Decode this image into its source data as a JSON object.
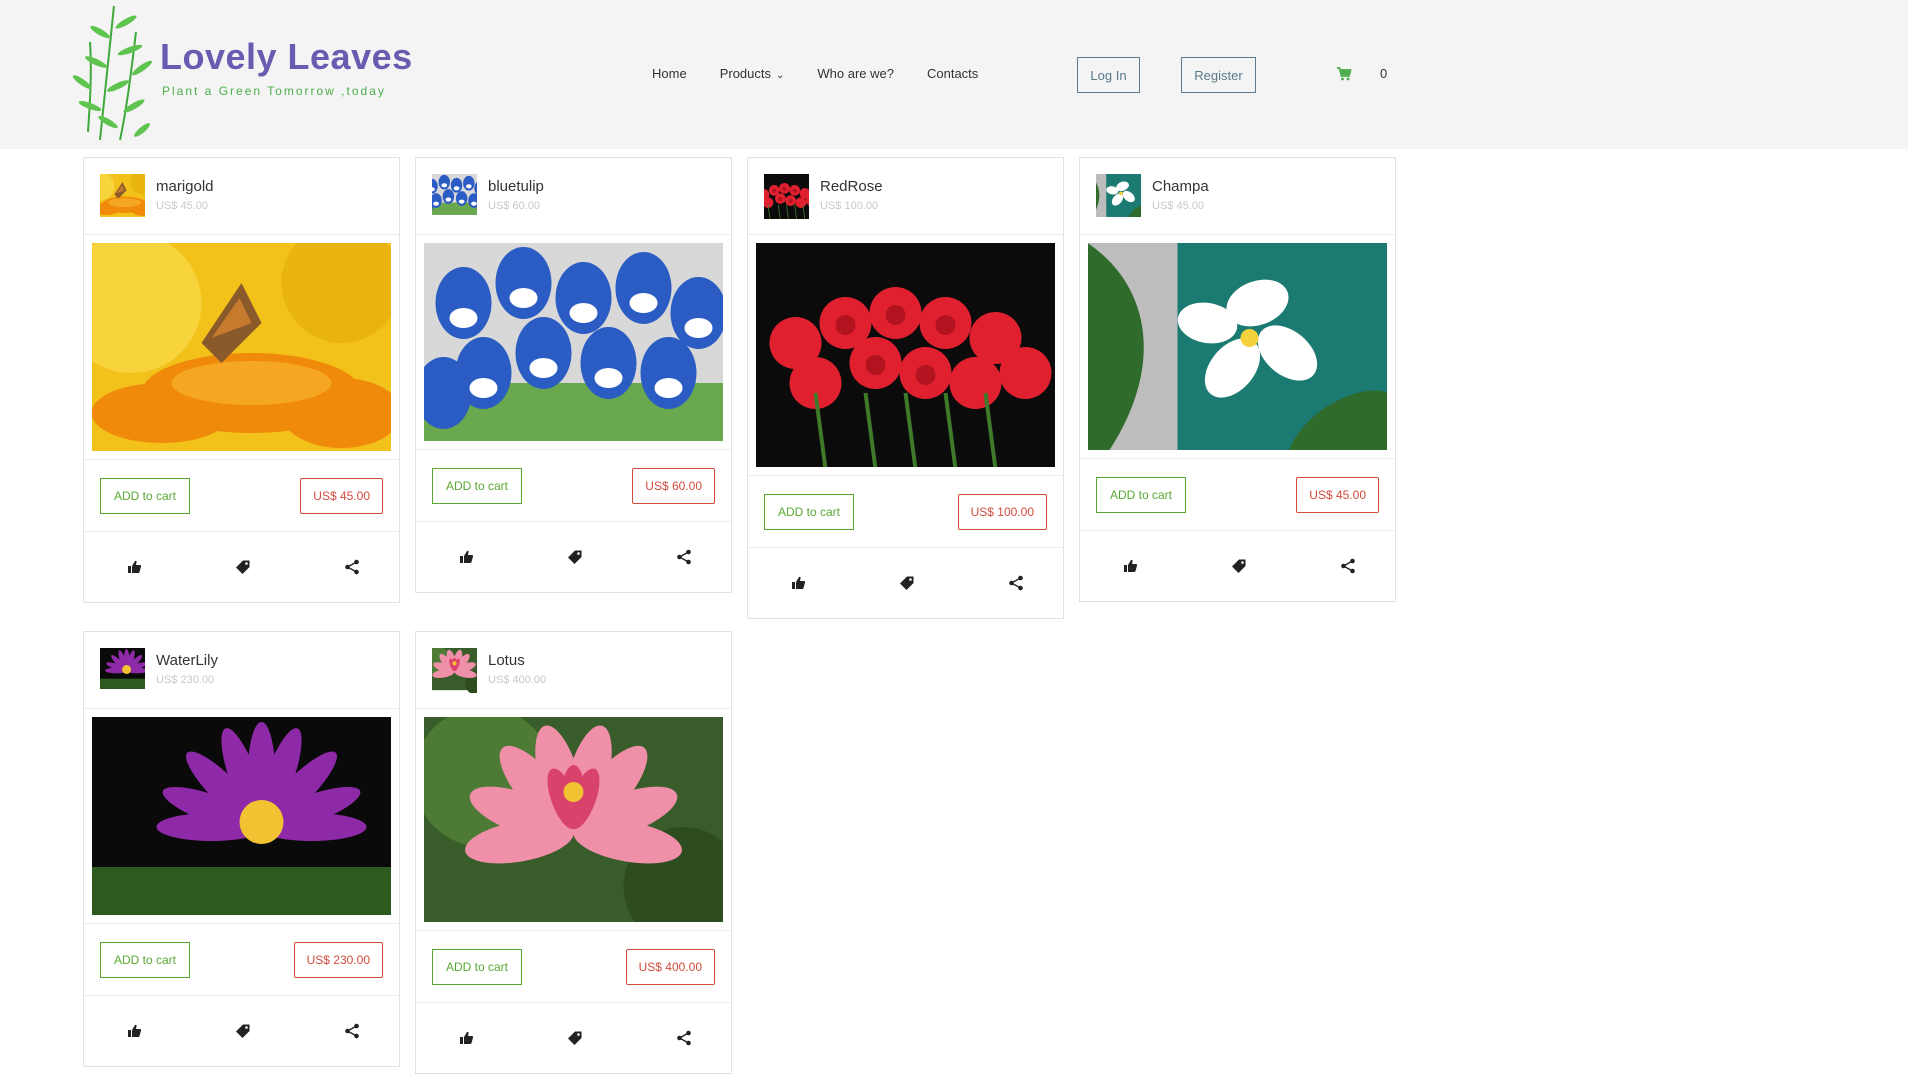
{
  "brand": {
    "title": "Lovely Leaves",
    "tagline": "Plant a Green Tomorrow ,today",
    "accent": "#6a5bb0",
    "tagline_color": "#4cae4c"
  },
  "nav": {
    "home": "Home",
    "products": "Products",
    "who": "Who are we?",
    "contacts": "Contacts"
  },
  "auth": {
    "login": "Log In",
    "register": "Register"
  },
  "cart": {
    "icon": "shopping-cart-icon",
    "count": "0"
  },
  "colors": {
    "add_green": "#5aa832",
    "price_red": "#d24b3c"
  },
  "products": [
    {
      "name": "marigold",
      "subprice": "US$ 45.00",
      "add": "ADD to cart",
      "price": "US$ 45.00"
    },
    {
      "name": "bluetulip",
      "subprice": "US$ 60.00",
      "add": "ADD to cart",
      "price": "US$ 60.00"
    },
    {
      "name": "RedRose",
      "subprice": "US$ 100.00",
      "add": "ADD to cart",
      "price": "US$ 100.00"
    },
    {
      "name": "Champa",
      "subprice": "US$ 45.00",
      "add": "ADD to cart",
      "price": "US$ 45.00"
    },
    {
      "name": "WaterLily",
      "subprice": "US$ 230.00",
      "add": "ADD to cart",
      "price": "US$ 230.00"
    },
    {
      "name": "Lotus",
      "subprice": "US$ 400.00",
      "add": "ADD to cart",
      "price": "US$ 400.00"
    }
  ],
  "footer_icons": [
    "thumbs-up-icon",
    "tag-icon",
    "share-icon"
  ]
}
